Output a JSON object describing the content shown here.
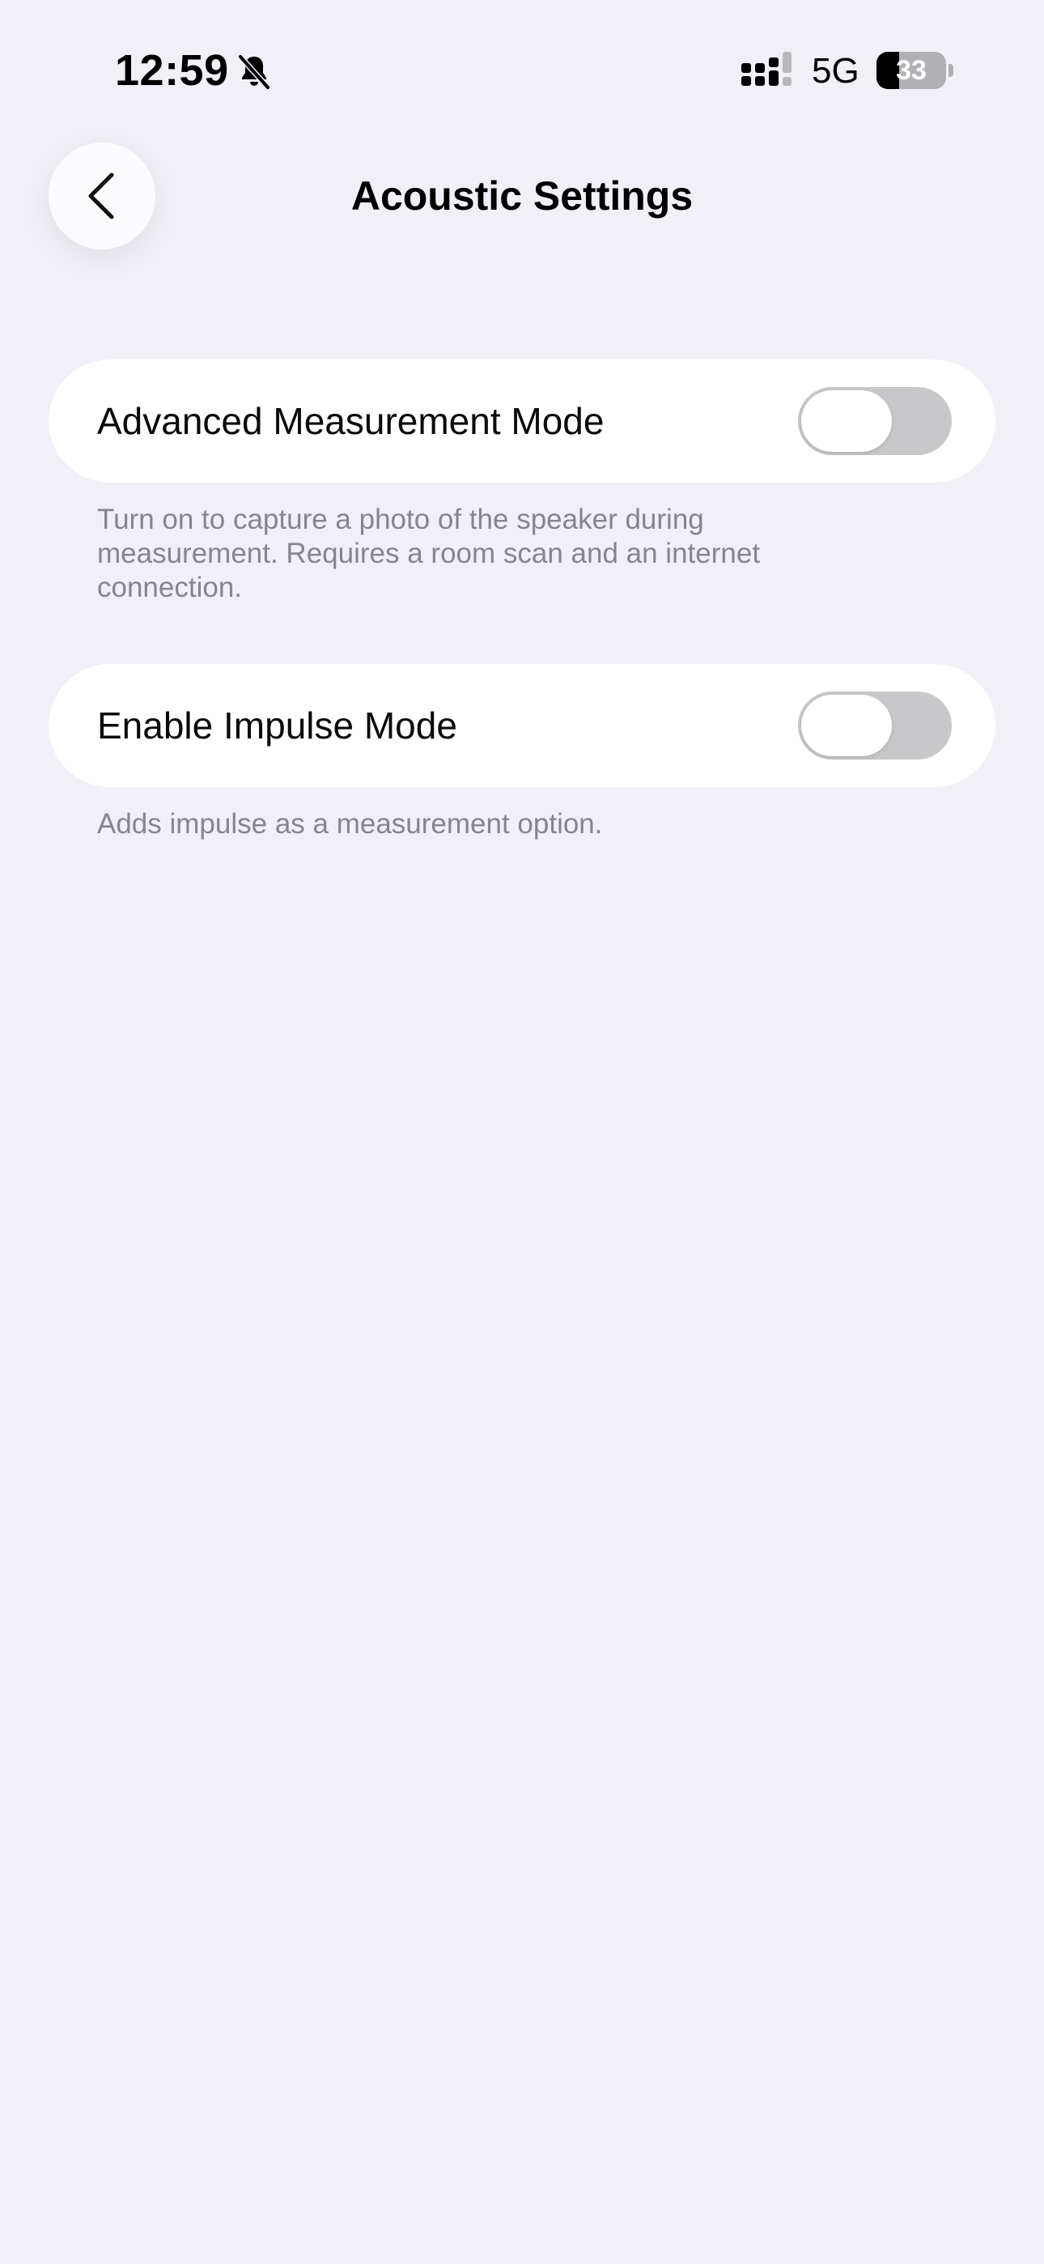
{
  "status_bar": {
    "time": "12:59",
    "network": "5G",
    "battery_level": "33",
    "battery_fraction": 0.33,
    "icons": [
      "bell-slash-icon",
      "signal-icon",
      "battery-icon"
    ]
  },
  "nav": {
    "back_icon": "chevron-left-icon",
    "title": "Acoustic Settings"
  },
  "settings": [
    {
      "label": "Advanced Measurement Mode",
      "enabled": false,
      "footnote": "Turn on to capture a photo of the speaker during measurement. Requires a room scan and an internet connection."
    },
    {
      "label": "Enable Impulse Mode",
      "enabled": false,
      "footnote": "Adds impulse as a measurement option."
    }
  ],
  "colors": {
    "background": "#f1f0f6",
    "card": "#ffffff",
    "toggle_off": "#c8c8ca",
    "footnote_text": "#85858b"
  }
}
